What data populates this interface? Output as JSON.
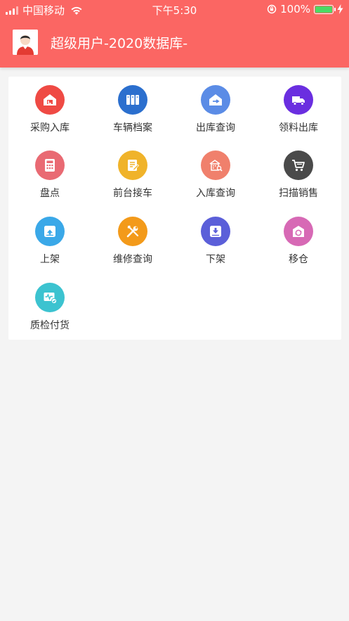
{
  "status_bar": {
    "carrier": "中国移动",
    "time": "下午5:30",
    "battery": "100%"
  },
  "header": {
    "title": "超级用户-2020数据库-"
  },
  "colors": {
    "header_bg": "#fb6663"
  },
  "grid": [
    {
      "label": "采购入库",
      "icon": "warehouse-in-icon",
      "color": "#ef4a44"
    },
    {
      "label": "车辆档案",
      "icon": "archive-icon",
      "color": "#2b6fce"
    },
    {
      "label": "出库查询",
      "icon": "outbound-icon",
      "color": "#5b8ce6"
    },
    {
      "label": "领料出库",
      "icon": "truck-icon",
      "color": "#6a2ee0"
    },
    {
      "label": "盘点",
      "icon": "calculator-icon",
      "color": "#e96a73"
    },
    {
      "label": "前台接车",
      "icon": "note-edit-icon",
      "color": "#f0b32a"
    },
    {
      "label": "入库查询",
      "icon": "building-search-icon",
      "color": "#f0806c"
    },
    {
      "label": "扫描销售",
      "icon": "cart-icon",
      "color": "#4a4a4a"
    },
    {
      "label": "上架",
      "icon": "shelf-up-icon",
      "color": "#3aa8e8"
    },
    {
      "label": "维修查询",
      "icon": "tools-icon",
      "color": "#f39a1a"
    },
    {
      "label": "下架",
      "icon": "shelf-down-icon",
      "color": "#5b5fd9"
    },
    {
      "label": "移仓",
      "icon": "move-warehouse-icon",
      "color": "#d769b5"
    },
    {
      "label": "质检付货",
      "icon": "quality-check-icon",
      "color": "#3cc3d0"
    }
  ]
}
